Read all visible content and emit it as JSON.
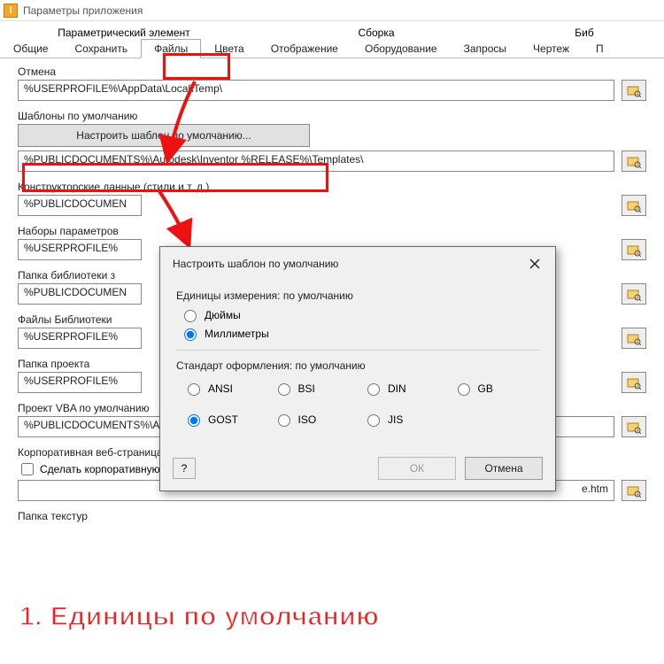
{
  "window": {
    "title": "Параметры приложения"
  },
  "tabsUpper": {
    "a": "Параметрический элемент",
    "b": "Сборка",
    "c": "Биб"
  },
  "tabsLower": {
    "t0": "Общие",
    "t1": "Сохранить",
    "t2": "Файлы",
    "t3": "Цвета",
    "t4": "Отображение",
    "t5": "Оборудование",
    "t6": "Запросы",
    "t7": "Чертеж",
    "t8": "П"
  },
  "fields": {
    "undo": {
      "label": "Отмена",
      "value": "%USERPROFILE%\\AppData\\Local\\Temp\\"
    },
    "templates": {
      "label": "Шаблоны по умолчанию",
      "btn": "Настроить шаблон по умолчанию...",
      "value": "%PUBLICDOCUMENTS%\\Autodesk\\Inventor %RELEASE%\\Templates\\"
    },
    "design": {
      "label": "Конструкторские данные (стили и т. д.)",
      "value": "%PUBLICDOCUMEN"
    },
    "paramsets": {
      "label": "Наборы параметров",
      "value": "%USERPROFILE%"
    },
    "libfolder": {
      "label": "Папка библиотеки з",
      "value": "%PUBLICDOCUMEN"
    },
    "libfiles": {
      "label": "Файлы Библиотеки",
      "value": "%USERPROFILE%"
    },
    "project": {
      "label": "Папка проекта",
      "value": "%USERPROFILE%"
    },
    "vba": {
      "label": "Проект VBA по умолчанию",
      "value": "%PUBLICDOCUMENTS%\\Autodesk\\Inventor %RELEASE%\\Macros\\Default.ivb"
    },
    "corp": {
      "label": "Корпоративная веб-страница",
      "check": "Сделать корпоративную веб-страницу моей главной страницей по умолчанию",
      "value": "e.htm"
    },
    "textures": {
      "label": "Папка текстур"
    }
  },
  "dialog": {
    "title": "Настроить шаблон по умолчанию",
    "unitsLabel": "Единицы измерения: по умолчанию",
    "unitInch": "Дюймы",
    "unitMm": "Миллиметры",
    "stdLabel": "Стандарт оформления: по умолчанию",
    "std": {
      "ansi": "ANSI",
      "bsi": "BSI",
      "din": "DIN",
      "gb": "GB",
      "gost": "GOST",
      "iso": "ISO",
      "jis": "JIS"
    },
    "ok": "ОК",
    "cancel": "Отмена",
    "help": "?"
  },
  "annotation": "1. Единицы по умолчанию"
}
